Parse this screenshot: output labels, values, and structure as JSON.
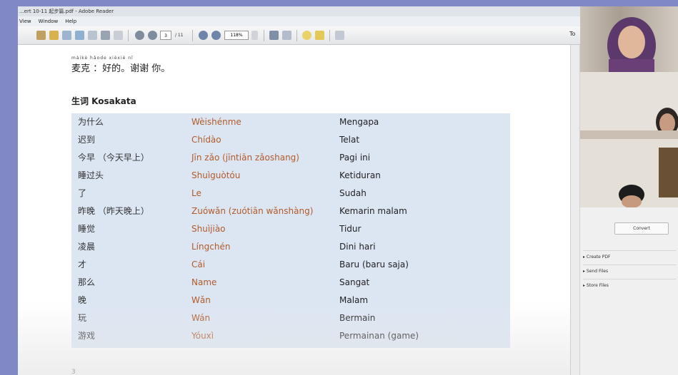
{
  "window": {
    "title": "...ert 10-11 起步篇.pdf - Adobe Reader"
  },
  "menu": [
    "View",
    "Window",
    "Help"
  ],
  "toolbar": {
    "page_current": "3",
    "page_total": "/ 11",
    "zoom": "118%",
    "right_tab": "To"
  },
  "document": {
    "pinyin_line": "màikè    hǎode   xièxiè nǐ",
    "dialogue": "麦克 ：好的。谢谢 你。",
    "section_title": "生词 Kosakata",
    "vocab": [
      {
        "hanzi": "为什么",
        "pinyin": "Wèishénme",
        "meaning": "Mengapa"
      },
      {
        "hanzi": "迟到",
        "pinyin": "Chídào",
        "meaning": "Telat"
      },
      {
        "hanzi": "今早 （今天早上）",
        "pinyin": "Jīn zǎo (jīntiān zǎoshang)",
        "meaning": "Pagi ini"
      },
      {
        "hanzi": "睡过头",
        "pinyin": "Shuìguòtóu",
        "meaning": "Ketiduran"
      },
      {
        "hanzi": "了",
        "pinyin": "Le",
        "meaning": "Sudah"
      },
      {
        "hanzi": "昨晚 （昨天晚上）",
        "pinyin": "Zuówǎn (zuótiān wǎnshàng)",
        "meaning": "Kemarin malam"
      },
      {
        "hanzi": "睡觉",
        "pinyin": "Shuìjiào",
        "meaning": "Tidur"
      },
      {
        "hanzi": "凌晨",
        "pinyin": "Língchén",
        "meaning": "Dini hari"
      },
      {
        "hanzi": "才",
        "pinyin": "Cái",
        "meaning": "Baru (baru saja)"
      },
      {
        "hanzi": "那么",
        "pinyin": "Name",
        "meaning": "Sangat"
      },
      {
        "hanzi": "晚",
        "pinyin": "Wǎn",
        "meaning": "Malam"
      },
      {
        "hanzi": "玩",
        "pinyin": "Wán",
        "meaning": "Bermain"
      },
      {
        "hanzi": "游戏",
        "pinyin": "Yóuxì",
        "meaning": "Permainan (game)"
      }
    ],
    "page_number": "3"
  },
  "panel": {
    "convert": "Convert",
    "items": [
      "Create PDF",
      "Send Files",
      "Store Files"
    ]
  },
  "colors": {
    "page_bg": "#8089c6",
    "vocab_bg": "#dce6f3",
    "pinyin_color": "#b25a2a"
  }
}
